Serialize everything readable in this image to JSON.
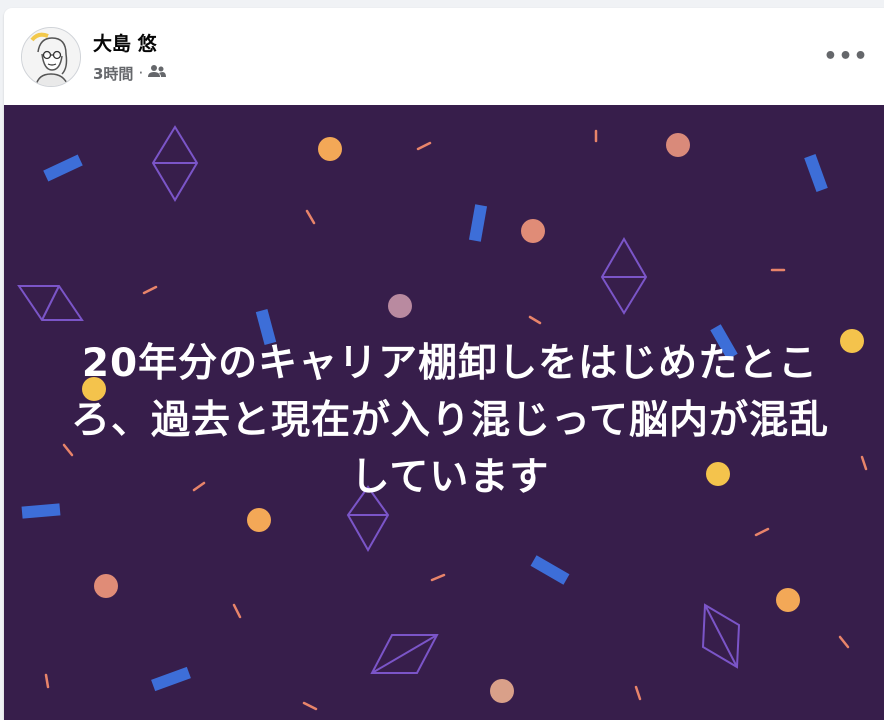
{
  "post": {
    "author_name": "大島 悠",
    "timestamp": "3時間",
    "separator": "·",
    "audience_icon": "friends-icon",
    "more_icon": "more-horizontal-icon",
    "more_label": "•••",
    "text": "20年分のキャリア棚卸しをはじめたところ、過去と現在が入り混じって脳内が混乱しています",
    "background_color": "#371e4b"
  }
}
